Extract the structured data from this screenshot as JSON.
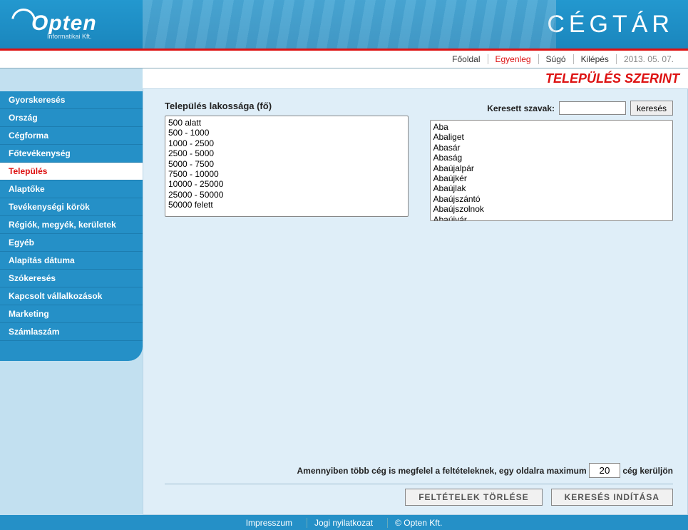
{
  "logo": {
    "brand": "Opten",
    "sub": "Informatikai Kft."
  },
  "apptitle": "CÉGTÁR",
  "topnav": {
    "home": "Főoldal",
    "balance": "Egyenleg",
    "help": "Súgó",
    "logout": "Kilépés",
    "date": "2013. 05. 07."
  },
  "sidebar": [
    "Gyorskeresés",
    "Ország",
    "Cégforma",
    "Főtevékenység",
    "Település",
    "Alaptőke",
    "Tevékenységi körök",
    "Régiók, megyék, kerületek",
    "Egyéb",
    "Alapítás dátuma",
    "Szókeresés",
    "Kapcsolt vállalkozások",
    "Marketing",
    "Számlaszám"
  ],
  "sidebar_active_index": 4,
  "page_title": "TELEPÜLÉS SZERINT",
  "left_heading": "Település lakossága (fő)",
  "population_options": [
    "500 alatt",
    "500 - 1000",
    "1000 - 2500",
    "2500 - 5000",
    "5000 - 7500",
    "7500 - 10000",
    "10000 - 25000",
    "25000 - 50000",
    "50000 felett"
  ],
  "search": {
    "label": "Keresett szavak:",
    "button": "keresés",
    "value": ""
  },
  "settlement_options": [
    "Aba",
    "Abaliget",
    "Abasár",
    "Abaság",
    "Abaújalpár",
    "Abaújkér",
    "Abaújlak",
    "Abaújszántó",
    "Abaújszolnok",
    "Abaújvár"
  ],
  "limit": {
    "before": "Amennyiben több cég is megfelel a feltételeknek, egy oldalra maximum",
    "value": "20",
    "after": "cég kerüljön"
  },
  "buttons": {
    "clear": "FELTÉTELEK TÖRLÉSE",
    "search": "KERESÉS INDÍTÁSA"
  },
  "footer": {
    "imprint": "Impresszum",
    "legal": "Jogi nyilatkozat",
    "copy": "© Opten Kft."
  }
}
